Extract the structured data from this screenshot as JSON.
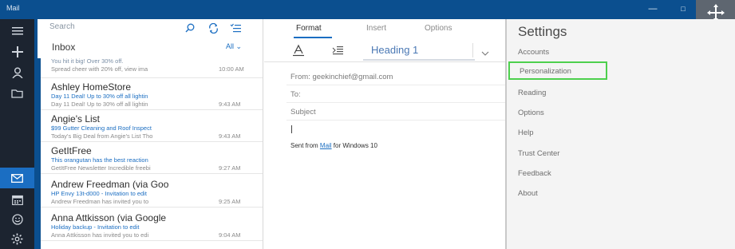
{
  "titlebar": {
    "app_title": "Mail"
  },
  "search": {
    "placeholder": "Search"
  },
  "folder": {
    "name": "Inbox",
    "filter": "All"
  },
  "messages": [
    {
      "sender": "",
      "subject": "You hit it big! Over 30% off.",
      "preview": "Spread cheer with 20% off, view ima",
      "time": "10:00 AM"
    },
    {
      "sender": "Ashley HomeStore",
      "subject": "Day 11 Deal! Up to 30% off all lightin",
      "preview": "Day 11 Deal! Up to 30% off all lightin",
      "time": "9:43 AM"
    },
    {
      "sender": "Angie's List",
      "subject": "$99 Gutter Cleaning and Roof Inspect",
      "preview": "Today's Big Deal from Angie's List Tho",
      "time": "9:43 AM"
    },
    {
      "sender": "GetItFree",
      "subject": "This orangutan has the best reaction",
      "preview": "GetItFree Newsletter Incredible freebi",
      "time": "9:27 AM"
    },
    {
      "sender": "Andrew Freedman (via Goo",
      "subject": "HP Envy 13t-d000 - Invitation to edit",
      "preview": "Andrew Freedman has invited you to",
      "time": "9:25 AM"
    },
    {
      "sender": "Anna Attkisson (via Google",
      "subject": "Holiday backup - Invitation to edit",
      "preview": "Anna Attkisson has invited you to edi",
      "time": "9:04 AM"
    }
  ],
  "compose": {
    "tabs": [
      "Format",
      "Insert",
      "Options"
    ],
    "style_value": "Heading 1",
    "from": "From: geekinchief@gmail.com",
    "to": "To:",
    "subject": "Subject",
    "signature_prefix": "Sent from ",
    "signature_link": "Mail",
    "signature_suffix": " for Windows 10"
  },
  "settings": {
    "title": "Settings",
    "items": [
      "Accounts",
      "Personalization",
      "Reading",
      "Options",
      "Help",
      "Trust Center",
      "Feedback",
      "About"
    ]
  },
  "colors": {
    "accent": "#1b6ec2",
    "titlebar": "#0b4f8f",
    "rail": "#1c2430",
    "highlight": "#4dd04d"
  }
}
